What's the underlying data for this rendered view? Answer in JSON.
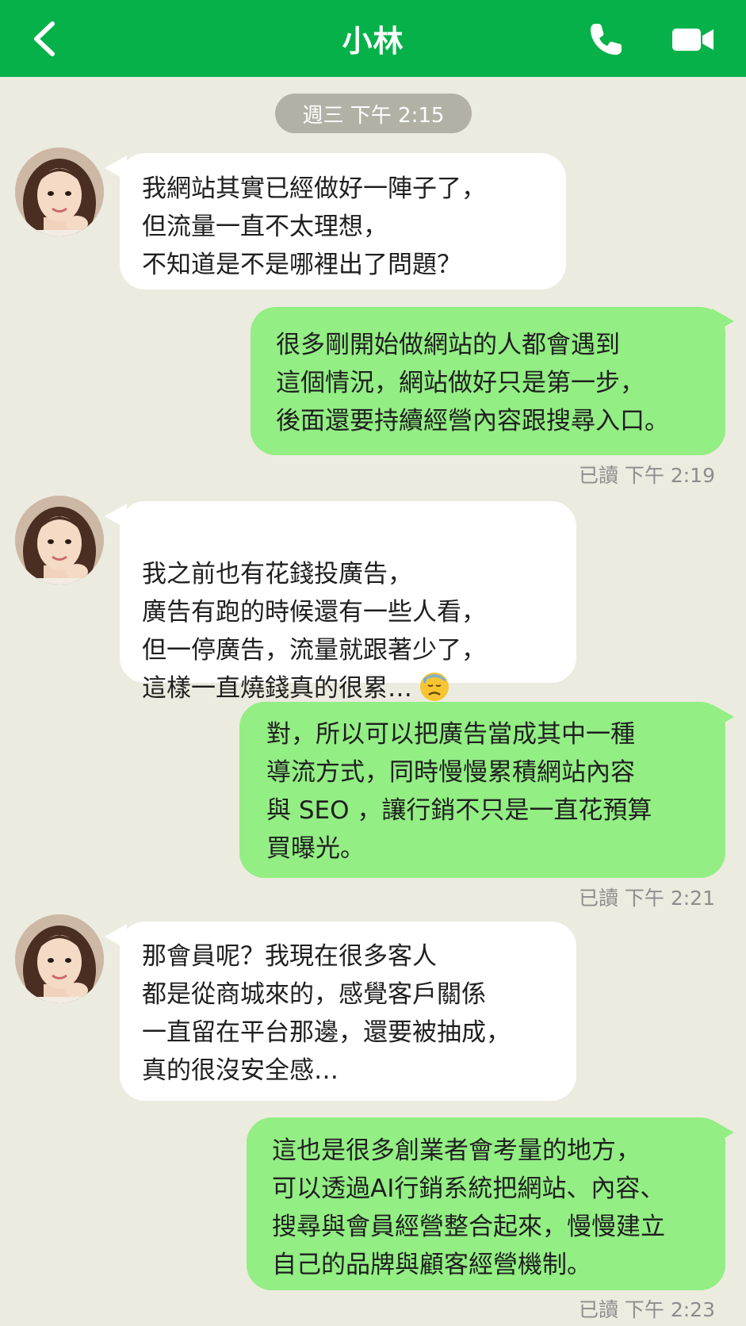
{
  "header": {
    "title": "小林",
    "back_icon": "chevron-left-icon",
    "phone_icon": "phone-icon",
    "video_icon": "video-camera-icon",
    "accent_color": "#06b14a"
  },
  "date_label": "週三  下午 2:15",
  "messages": [
    {
      "sender": "contact",
      "text": "我網站其實已經做好一陣子了，\n但流量一直不太理想，\n不知道是不是哪裡出了問題？"
    },
    {
      "sender": "me",
      "text": "很多剛開始做網站的人都會遇到\n這個情況，網站做好只是第一步，\n後面還要持續經營內容跟搜尋入口。",
      "status": "已讀  下午 2:19"
    },
    {
      "sender": "contact",
      "text": "我之前也有花錢投廣告，\n廣告有跑的時候還有一些人看，\n但一停廣告，流量就跟著少了，\n這樣一直燒錢真的很累…",
      "emoji": "😓"
    },
    {
      "sender": "me",
      "text": "對，所以可以把廣告當成其中一種\n導流方式，同時慢慢累積網站內容\n與 SEO ，讓行銷不只是一直花預算\n買曝光。",
      "status": "已讀  下午 2:21"
    },
    {
      "sender": "contact",
      "text": "那會員呢？我現在很多客人\n都是從商城來的，感覺客戶關係\n一直留在平台那邊，還要被抽成，\n真的很沒安全感…"
    },
    {
      "sender": "me",
      "text": "這也是很多創業者會考量的地方，\n可以透過AI行銷系統把網站、內容、\n搜尋與會員經營整合起來，慢慢建立\n自己的品牌與顧客經營機制。",
      "status": "已讀  下午 2:23"
    }
  ],
  "colors": {
    "background": "#ecebdf",
    "incoming_bubble": "#ffffff",
    "outgoing_bubble": "#93ee84",
    "date_pill": "#b3b0a5",
    "read_status": "#8d8d8d"
  },
  "avatar_icon": "contact-avatar"
}
